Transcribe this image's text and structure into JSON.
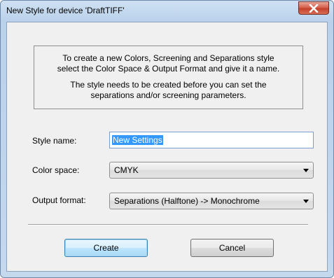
{
  "window": {
    "title": "New Style for device 'DraftTIFF'"
  },
  "info": {
    "line1": "To create a new Colors, Screening and Separations style",
    "line2": "select the Color Space & Output Format and give it a name.",
    "line3": "The style needs to be created before you can set the",
    "line4": "separations and/or  screening parameters."
  },
  "form": {
    "style_name_label": "Style name:",
    "style_name_value": "New Settings",
    "color_space_label": "Color space:",
    "color_space_value": "CMYK",
    "output_format_label": "Output format:",
    "output_format_value": "Separations (Halftone) -> Monochrome"
  },
  "buttons": {
    "create": "Create",
    "cancel": "Cancel"
  },
  "icons": {
    "close": "close-icon",
    "dropdown": "chevron-down-icon"
  }
}
